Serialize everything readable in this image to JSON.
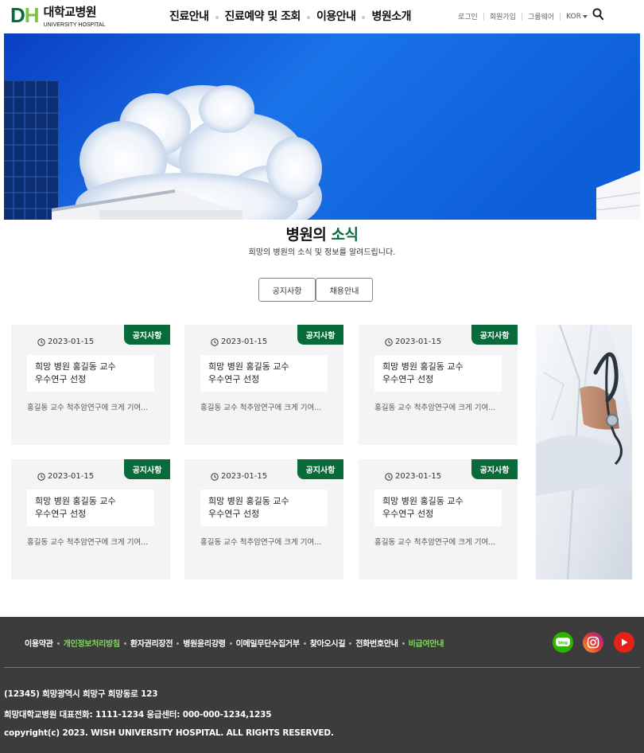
{
  "header": {
    "logo": {
      "mark_d": "D",
      "mark_h": "H",
      "name": "대학교병원",
      "name_en": "UNIVERSITY HOSPITAL"
    },
    "nav": [
      "진료안내",
      "진료예약 및 조회",
      "이용안내",
      "병원소개"
    ],
    "utility": {
      "login": "로그인",
      "signup": "회원가입",
      "groupware": "그룹웨어",
      "language": "KOR"
    }
  },
  "section": {
    "title_main": "병원의",
    "title_accent": "소식",
    "subtitle": "희망의 병원의 소식 및 정보를 알려드립니다.",
    "tabs": [
      "공지사항",
      "채용안내"
    ]
  },
  "cards": [
    {
      "badge": "공지사항",
      "date": "2023-01-15",
      "title_line1": "희망 병원 홍길동 교수",
      "title_line2": "우수연구 선정",
      "desc": "홍길동 교수 척추암연구에 크게 기여..."
    },
    {
      "badge": "공지사항",
      "date": "2023-01-15",
      "title_line1": "희망 병원 홍길동 교수",
      "title_line2": "우수연구 선정",
      "desc": "홍길동 교수 척추암연구에 크게 기여..."
    },
    {
      "badge": "공지사항",
      "date": "2023-01-15",
      "title_line1": "희망 병원 홍길동 교수",
      "title_line2": "우수연구 선정",
      "desc": "홍길동 교수 척추암연구에 크게 기여..."
    },
    {
      "badge": "공지사항",
      "date": "2023-01-15",
      "title_line1": "희망 병원 홍길동 교수",
      "title_line2": "우수연구 선정",
      "desc": "홍길동 교수 척추암연구에 크게 기여..."
    },
    {
      "badge": "공지사항",
      "date": "2023-01-15",
      "title_line1": "희망 병원 홍길동 교수",
      "title_line2": "우수연구 선정",
      "desc": "홍길동 교수 척추암연구에 크게 기여..."
    },
    {
      "badge": "공지사항",
      "date": "2023-01-15",
      "title_line1": "희망 병원 홍길동 교수",
      "title_line2": "우수연구 선정",
      "desc": "홍길동 교수 척추암연구에 크게 기여..."
    }
  ],
  "footer": {
    "links": [
      {
        "label": "이용약관",
        "highlight": false
      },
      {
        "label": "개인정보처리방침",
        "highlight": true
      },
      {
        "label": "환자권리장전",
        "highlight": false
      },
      {
        "label": "병원윤리강령",
        "highlight": false
      },
      {
        "label": "이메일무단수집거부",
        "highlight": false
      },
      {
        "label": "찾아오시길",
        "highlight": false
      },
      {
        "label": "전화번호안내",
        "highlight": false
      },
      {
        "label": "비급여안내",
        "highlight": true
      }
    ],
    "sns": {
      "blog": "blog"
    },
    "address": "(12345) 희망광역시 희망구 희망동로 123",
    "phone": "희망대학교병원 대표전화: 1111-1234 응급센터: 000-000-1234,1235",
    "copyright": "copyright(c) 2023. WISH UNIVERSITY HOSPITAL. ALL RIGHTS RESERVED."
  },
  "colors": {
    "brand_green": "#0a6b3a",
    "light_green": "#7cc242",
    "footer_bg": "#3c3c3c",
    "footer_highlight": "#7ed957"
  }
}
